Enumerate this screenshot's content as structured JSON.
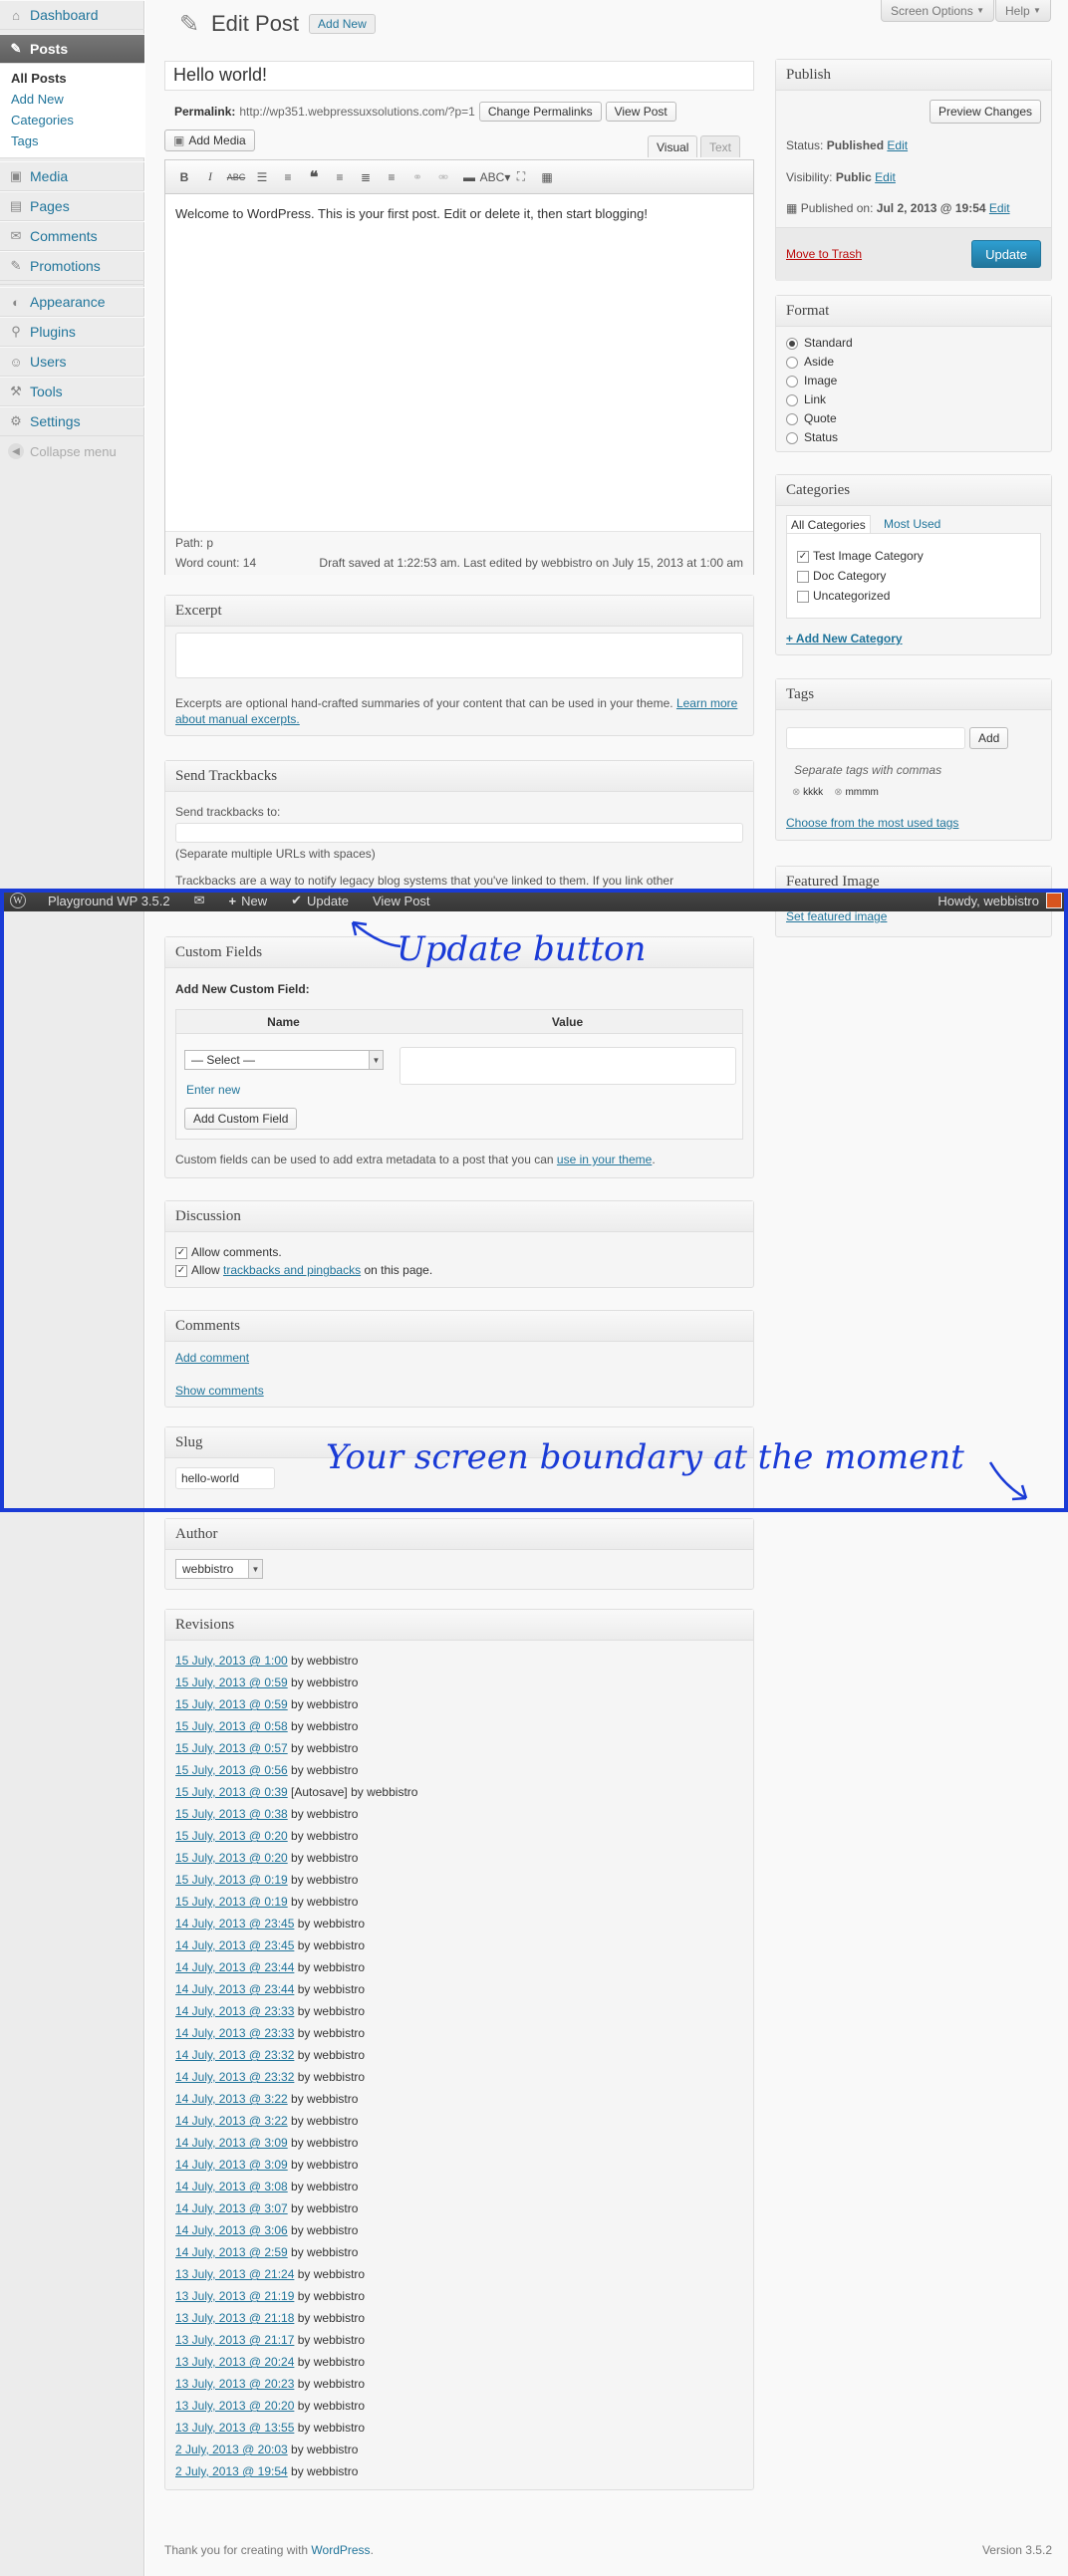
{
  "sidebar": {
    "top_items": [
      {
        "label": "Dashboard",
        "icon": "dashboard-icon"
      },
      {
        "label": "Posts",
        "icon": "pin-icon"
      }
    ],
    "posts_submenu": [
      "All Posts",
      "Add New",
      "Categories",
      "Tags"
    ],
    "items": [
      {
        "label": "Media",
        "icon": "media-icon"
      },
      {
        "label": "Pages",
        "icon": "pages-icon"
      },
      {
        "label": "Comments",
        "icon": "comments-icon"
      },
      {
        "label": "Promotions",
        "icon": "pin-icon"
      },
      {
        "label": "Appearance",
        "icon": "appearance-icon"
      },
      {
        "label": "Plugins",
        "icon": "plugins-icon"
      },
      {
        "label": "Users",
        "icon": "users-icon"
      },
      {
        "label": "Tools",
        "icon": "tools-icon"
      },
      {
        "label": "Settings",
        "icon": "settings-icon"
      }
    ],
    "collapse_label": "Collapse menu"
  },
  "header": {
    "screen_options": "Screen Options",
    "help": "Help",
    "title": "Edit Post",
    "add_new": "Add New"
  },
  "post": {
    "title": "Hello world!",
    "permalink_label": "Permalink:",
    "permalink_url": "http://wp351.webpressuxsolutions.com/?p=1",
    "change_permalinks": "Change Permalinks",
    "view_post": "View Post",
    "add_media": "Add Media",
    "tab_visual": "Visual",
    "tab_text": "Text",
    "content": "Welcome to WordPress. This is your first post. Edit or delete it, then start blogging!",
    "path": "Path: p",
    "word_count": "Word count: 14",
    "draft_status": "Draft saved at 1:22:53 am. Last edited by webbistro on July 15, 2013 at 1:00 am"
  },
  "excerpt": {
    "heading": "Excerpt",
    "help_text": "Excerpts are optional hand-crafted summaries of your content that can be used in your theme.",
    "learn_more": "Learn more about manual excerpts."
  },
  "trackbacks": {
    "heading": "Send Trackbacks",
    "label": "Send trackbacks to:",
    "hint": "(Separate multiple URLs with spaces)",
    "help_text": "Trackbacks are a way to notify legacy blog systems that you've linked to them. If you link other"
  },
  "publish": {
    "heading": "Publish",
    "preview": "Preview Changes",
    "status_label": "Status:",
    "status_value": "Published",
    "visibility_label": "Visibility:",
    "visibility_value": "Public",
    "edit": "Edit",
    "published_label": "Published on:",
    "published_value": "Jul 2, 2013 @ 19:54",
    "trash": "Move to Trash",
    "update": "Update"
  },
  "format": {
    "heading": "Format",
    "options": [
      "Standard",
      "Aside",
      "Image",
      "Link",
      "Quote",
      "Status"
    ],
    "selected": "Standard"
  },
  "categories": {
    "heading": "Categories",
    "tab_all": "All Categories",
    "tab_most_used": "Most Used",
    "items": [
      {
        "label": "Test Image Category",
        "checked": true
      },
      {
        "label": "Doc Category",
        "checked": false
      },
      {
        "label": "Uncategorized",
        "checked": false
      }
    ],
    "add_new": "+ Add New Category"
  },
  "tags": {
    "heading": "Tags",
    "add_button": "Add",
    "hint": "Separate tags with commas",
    "items": [
      "kkkk",
      "mmmm"
    ],
    "choose": "Choose from the most used tags"
  },
  "featured_image": {
    "heading": "Featured Image",
    "link": "Set featured image"
  },
  "adminbar": {
    "site": "Playground WP 3.5.2",
    "new": "New",
    "update": "Update",
    "view_post": "View Post",
    "howdy": "Howdy, webbistro"
  },
  "custom_fields": {
    "heading": "Custom Fields",
    "add_new_label": "Add New Custom Field:",
    "col_name": "Name",
    "col_value": "Value",
    "select_placeholder": "— Select —",
    "enter_new": "Enter new",
    "add_button": "Add Custom Field",
    "help_text": "Custom fields can be used to add extra metadata to a post that you can",
    "help_link": "use in your theme"
  },
  "discussion": {
    "heading": "Discussion",
    "allow_comments": "Allow comments.",
    "allow_prefix": "Allow",
    "trackbacks_link": "trackbacks and pingbacks",
    "allow_suffix": "on this page."
  },
  "comments": {
    "heading": "Comments",
    "add": "Add comment",
    "show": "Show comments"
  },
  "slug": {
    "heading": "Slug",
    "value": "hello-world"
  },
  "author": {
    "heading": "Author",
    "value": "webbistro"
  },
  "revisions": {
    "heading": "Revisions",
    "items": [
      {
        "date": "15 July, 2013 @ 1:00",
        "suffix": "by webbistro"
      },
      {
        "date": "15 July, 2013 @ 0:59",
        "suffix": "by webbistro"
      },
      {
        "date": "15 July, 2013 @ 0:59",
        "suffix": "by webbistro"
      },
      {
        "date": "15 July, 2013 @ 0:58",
        "suffix": "by webbistro"
      },
      {
        "date": "15 July, 2013 @ 0:57",
        "suffix": "by webbistro"
      },
      {
        "date": "15 July, 2013 @ 0:56",
        "suffix": "by webbistro"
      },
      {
        "date": "15 July, 2013 @ 0:39",
        "suffix": "[Autosave] by webbistro"
      },
      {
        "date": "15 July, 2013 @ 0:38",
        "suffix": "by webbistro"
      },
      {
        "date": "15 July, 2013 @ 0:20",
        "suffix": "by webbistro"
      },
      {
        "date": "15 July, 2013 @ 0:20",
        "suffix": "by webbistro"
      },
      {
        "date": "15 July, 2013 @ 0:19",
        "suffix": "by webbistro"
      },
      {
        "date": "15 July, 2013 @ 0:19",
        "suffix": "by webbistro"
      },
      {
        "date": "14 July, 2013 @ 23:45",
        "suffix": "by webbistro"
      },
      {
        "date": "14 July, 2013 @ 23:45",
        "suffix": "by webbistro"
      },
      {
        "date": "14 July, 2013 @ 23:44",
        "suffix": "by webbistro"
      },
      {
        "date": "14 July, 2013 @ 23:44",
        "suffix": "by webbistro"
      },
      {
        "date": "14 July, 2013 @ 23:33",
        "suffix": "by webbistro"
      },
      {
        "date": "14 July, 2013 @ 23:33",
        "suffix": "by webbistro"
      },
      {
        "date": "14 July, 2013 @ 23:32",
        "suffix": "by webbistro"
      },
      {
        "date": "14 July, 2013 @ 23:32",
        "suffix": "by webbistro"
      },
      {
        "date": "14 July, 2013 @ 3:22",
        "suffix": "by webbistro"
      },
      {
        "date": "14 July, 2013 @ 3:22",
        "suffix": "by webbistro"
      },
      {
        "date": "14 July, 2013 @ 3:09",
        "suffix": "by webbistro"
      },
      {
        "date": "14 July, 2013 @ 3:09",
        "suffix": "by webbistro"
      },
      {
        "date": "14 July, 2013 @ 3:08",
        "suffix": "by webbistro"
      },
      {
        "date": "14 July, 2013 @ 3:07",
        "suffix": "by webbistro"
      },
      {
        "date": "14 July, 2013 @ 3:06",
        "suffix": "by webbistro"
      },
      {
        "date": "14 July, 2013 @ 2:59",
        "suffix": "by webbistro"
      },
      {
        "date": "13 July, 2013 @ 21:24",
        "suffix": "by webbistro"
      },
      {
        "date": "13 July, 2013 @ 21:19",
        "suffix": "by webbistro"
      },
      {
        "date": "13 July, 2013 @ 21:18",
        "suffix": "by webbistro"
      },
      {
        "date": "13 July, 2013 @ 21:17",
        "suffix": "by webbistro"
      },
      {
        "date": "13 July, 2013 @ 20:24",
        "suffix": "by webbistro"
      },
      {
        "date": "13 July, 2013 @ 20:23",
        "suffix": "by webbistro"
      },
      {
        "date": "13 July, 2013 @ 20:20",
        "suffix": "by webbistro"
      },
      {
        "date": "13 July, 2013 @ 13:55",
        "suffix": "by webbistro"
      },
      {
        "date": "2 July, 2013 @ 20:03",
        "suffix": "by webbistro"
      },
      {
        "date": "2 July, 2013 @ 19:54",
        "suffix": "by webbistro"
      }
    ]
  },
  "footer": {
    "thanks_prefix": "Thank you for creating with",
    "wordpress_link": "WordPress",
    "version": "Version 3.5.2"
  },
  "annotations": {
    "update_button": "Update button",
    "screen_boundary": "Your screen boundary at the moment"
  },
  "colors": {
    "annotation": "#1a3bd6",
    "link": "#21759b",
    "trash": "#bc0b0b",
    "primary_button": "#21759b"
  }
}
